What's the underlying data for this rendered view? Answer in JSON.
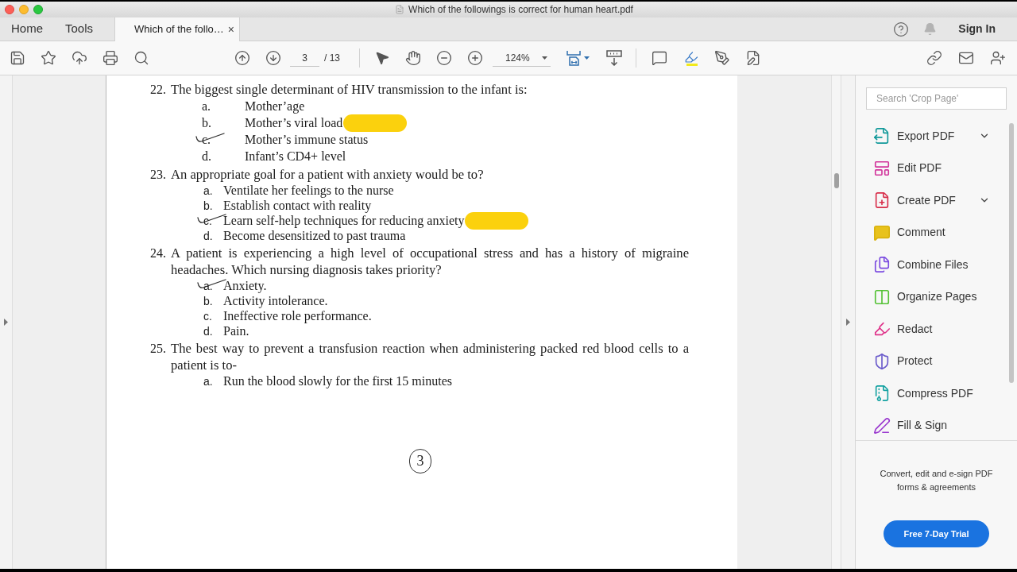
{
  "window": {
    "title": "Which of the followings is correct for human heart.pdf"
  },
  "tabs": [
    {
      "label": "Home",
      "selected": false
    },
    {
      "label": "Tools",
      "selected": false
    },
    {
      "label": "Which of the follo…",
      "selected": true,
      "close": "×"
    }
  ],
  "account": {
    "sign_in": "Sign In"
  },
  "toolbar": {
    "page_current": "3",
    "page_total": "/ 13",
    "zoom": "124%"
  },
  "document": {
    "questions": [
      {
        "number": "22.",
        "kind": "tabbed",
        "text": "The biggest single determinant of HIV transmission to the infant is:",
        "options": [
          {
            "letter": "a.",
            "text": "Mother’age",
            "marked": false,
            "highlighted": false
          },
          {
            "letter": "b.",
            "text": "Mother’s viral load",
            "marked": false,
            "highlighted": true
          },
          {
            "letter": "c.",
            "text": "Mother’s immune status",
            "marked": true,
            "highlighted": false
          },
          {
            "letter": "d.",
            "text": "Infant’s CD4+ level",
            "marked": false,
            "highlighted": false
          }
        ]
      },
      {
        "number": "23.",
        "kind": "compact",
        "text": "An appropriate goal for a patient with anxiety would be to?",
        "options": [
          {
            "letter": "a.",
            "text": "Ventilate her feelings to the nurse",
            "marked": false,
            "highlighted": false
          },
          {
            "letter": "b.",
            "text": "Establish contact with reality",
            "marked": false,
            "highlighted": false
          },
          {
            "letter": "c.",
            "text": "Learn self-help techniques for reducing anxiety",
            "marked": true,
            "highlighted": true
          },
          {
            "letter": "d.",
            "text": "Become desensitized to past trauma",
            "marked": false,
            "highlighted": false
          }
        ]
      },
      {
        "number": "24.",
        "kind": "compact",
        "text": "A patient is experiencing a high level of occupational stress and has a history of migraine headaches. Which nursing diagnosis takes priority?",
        "options": [
          {
            "letter": "a.",
            "text": "Anxiety.",
            "marked": true,
            "highlighted": false
          },
          {
            "letter": "b.",
            "text": "Activity intolerance.",
            "marked": false,
            "highlighted": false
          },
          {
            "letter": "c.",
            "text": "Ineffective role performance.",
            "marked": false,
            "highlighted": false
          },
          {
            "letter": "d.",
            "text": "Pain.",
            "marked": false,
            "highlighted": false
          }
        ]
      },
      {
        "number": "25.",
        "kind": "compact",
        "text": "The best way to prevent a transfusion reaction when administering packed red blood cells to a patient is to-",
        "options": [
          {
            "letter": "a.",
            "text": "Run the blood slowly for the first 15 minutes",
            "marked": false,
            "highlighted": false
          }
        ]
      }
    ],
    "page_mark": "3"
  },
  "tools_panel": {
    "search": {
      "placeholder": "Search 'Crop Page'"
    },
    "tools": [
      {
        "label": "Export PDF",
        "submenu": true
      },
      {
        "label": "Edit PDF",
        "submenu": false
      },
      {
        "label": "Create PDF",
        "submenu": true
      },
      {
        "label": "Comment",
        "submenu": false
      },
      {
        "label": "Combine Files",
        "submenu": false
      },
      {
        "label": "Organize Pages",
        "submenu": false
      },
      {
        "label": "Redact",
        "submenu": false
      },
      {
        "label": "Protect",
        "submenu": false
      },
      {
        "label": "Compress PDF",
        "submenu": false
      },
      {
        "label": "Fill & Sign",
        "submenu": false
      }
    ],
    "promo": {
      "text": "Convert, edit and e-sign PDF forms & agreements",
      "button": "Free 7-Day Trial"
    }
  }
}
